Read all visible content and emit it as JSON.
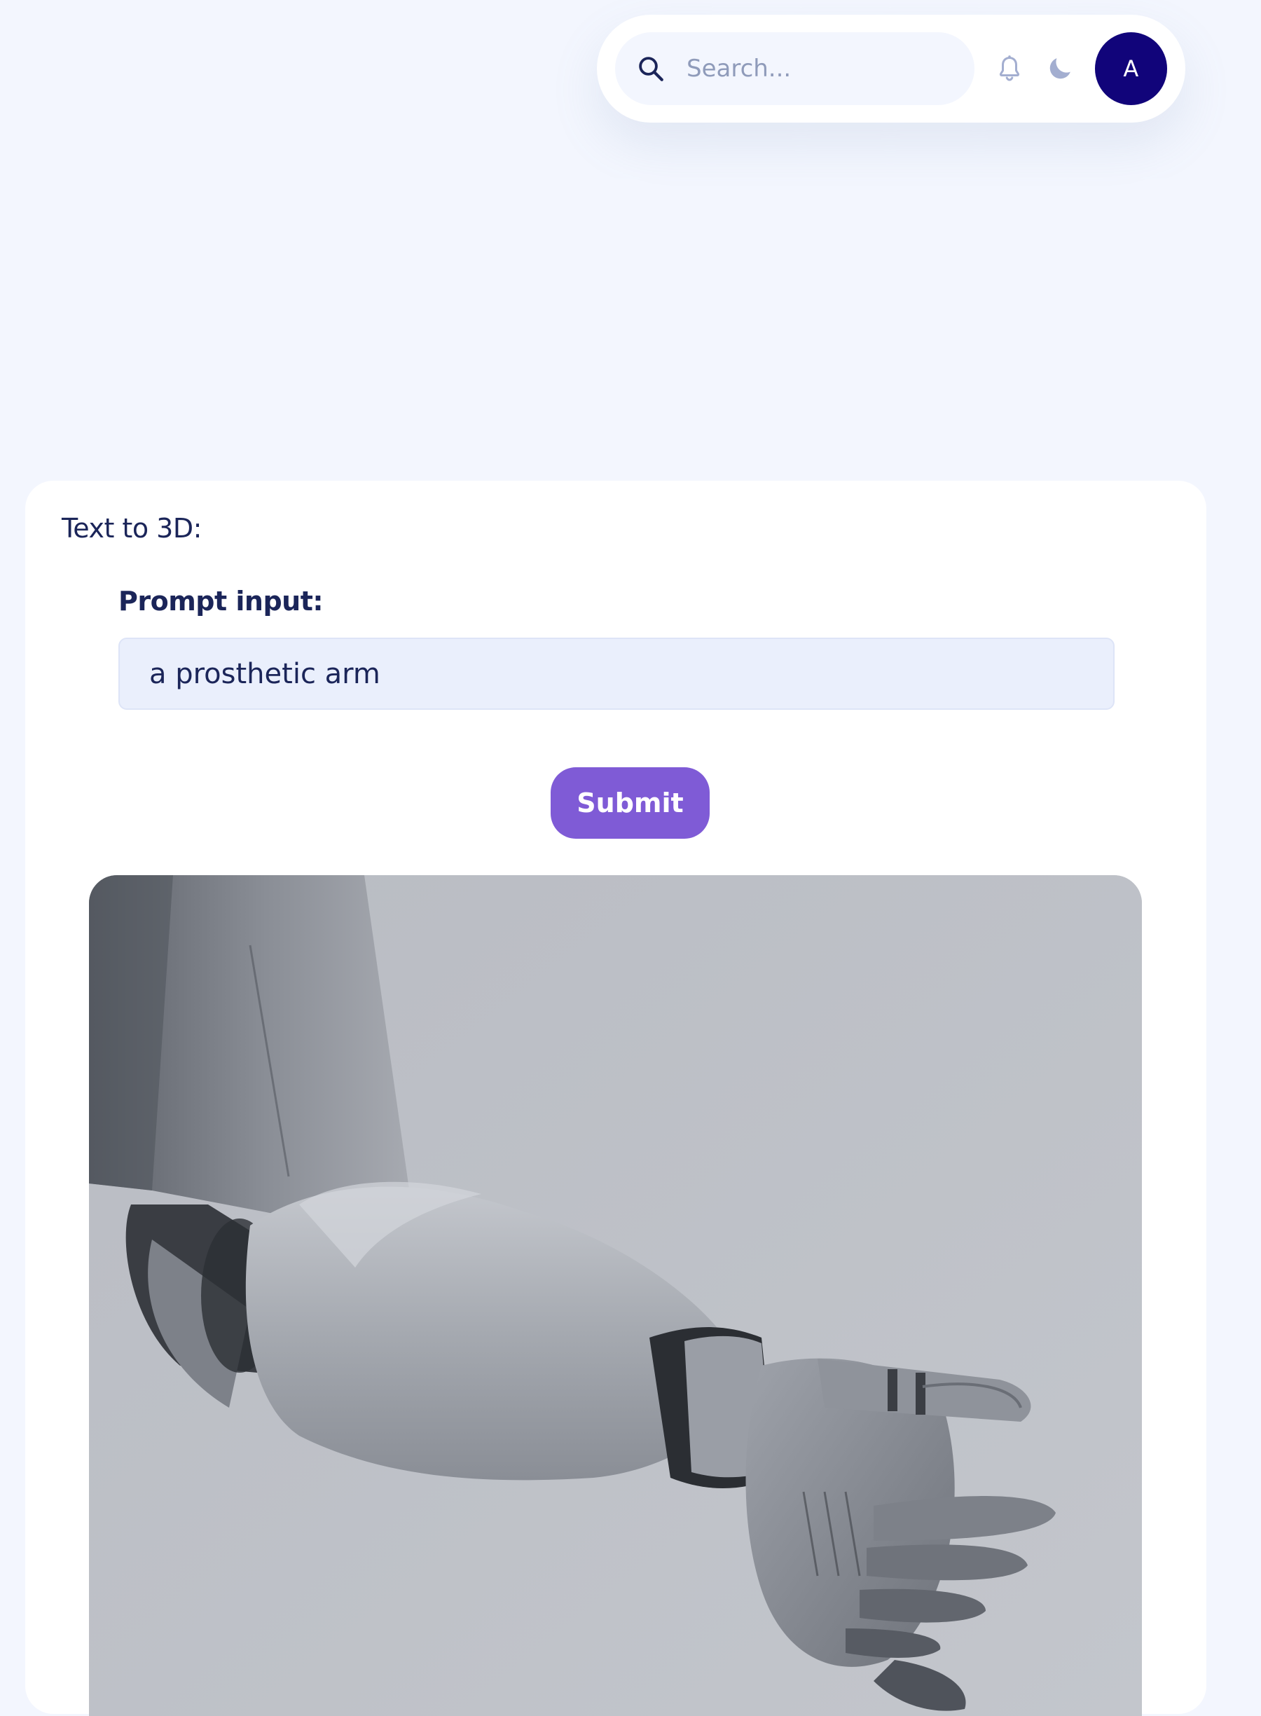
{
  "navbar": {
    "search": {
      "placeholder": "Search..."
    },
    "icons": [
      "search-icon",
      "bell-icon",
      "moon-icon"
    ],
    "avatar_initial": "A",
    "avatar_color": "#11047a"
  },
  "card": {
    "title": "Text to 3D:",
    "prompt_label": "Prompt input:",
    "prompt_value": "a prosthetic arm",
    "submit_label": "Submit"
  },
  "result": {
    "image_subject": "robotic prosthetic arm"
  },
  "colors": {
    "page_background": "#f3f6fe",
    "accent": "#7f5bd6",
    "input_background": "#eaeffc",
    "text_primary": "#1b2559",
    "muted_icon": "#a3aed0"
  }
}
